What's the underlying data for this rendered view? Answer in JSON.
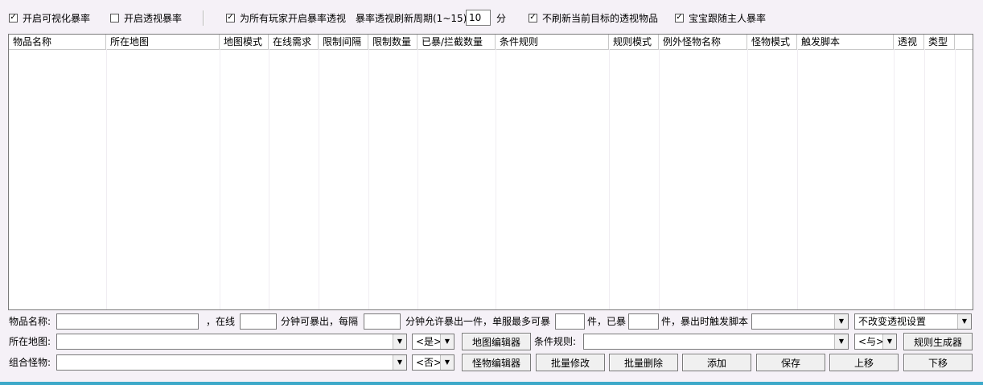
{
  "options": {
    "visual_drop_rate": {
      "label": "开启可视化暴率",
      "checked": true
    },
    "perspective_drop_rate": {
      "label": "开启透视暴率",
      "checked": false
    },
    "all_players_perspective": {
      "label": "为所有玩家开启暴率透视",
      "checked": true
    },
    "refresh_period_label": "暴率透视刷新周期(1~15):",
    "refresh_period_value": "10",
    "refresh_period_unit": "分",
    "no_refresh_target": {
      "label": "不刷新当前目标的透视物品",
      "checked": true
    },
    "pet_follow_master": {
      "label": "宝宝跟随主人暴率",
      "checked": true
    }
  },
  "table": {
    "columns": [
      "物品名称",
      "所在地图",
      "地图模式",
      "在线需求",
      "限制间隔",
      "限制数量",
      "已暴/拦截数量",
      "条件规则",
      "规则模式",
      "例外怪物名称",
      "怪物模式",
      "触发脚本",
      "透视",
      "类型"
    ],
    "rows": []
  },
  "form": {
    "item_name_label": "物品名称:",
    "online_label": "，在线",
    "minutes_drop_label": "分钟可暴出，每隔",
    "minutes_allow_label": "分钟允许暴出一件，单服最多可暴",
    "pieces_dropped_label": "件，已暴",
    "pieces_trigger_label": "件，暴出时触发脚本",
    "perspective_setting_value": "不改变透视设置",
    "map_label": "所在地图:",
    "map_mode_value": "<是>",
    "map_editor_button": "地图编辑器",
    "condition_rule_label": "条件规则:",
    "rule_mode_value": "<与>",
    "rule_generator_button": "规则生成器",
    "monster_group_label": "组合怪物:",
    "monster_mode_value": "<否>",
    "monster_editor_button": "怪物编辑器",
    "batch_modify_button": "批量修改",
    "batch_delete_button": "批量删除",
    "add_button": "添加",
    "save_button": "保存",
    "move_up_button": "上移",
    "move_down_button": "下移"
  }
}
